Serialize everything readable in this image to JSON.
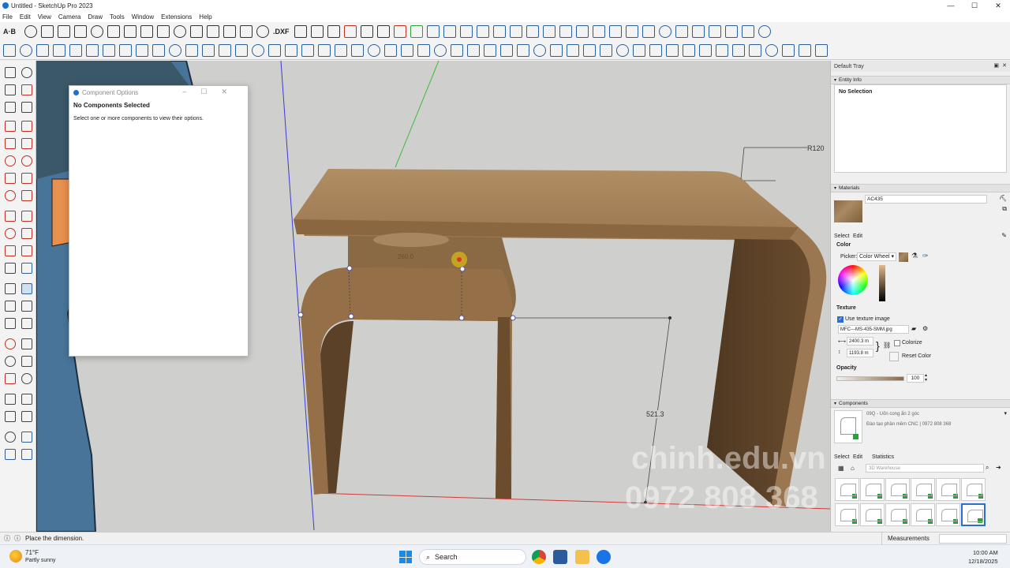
{
  "window": {
    "title": "Untitled - SketchUp Pro 2023"
  },
  "menu": [
    "File",
    "Edit",
    "View",
    "Camera",
    "Draw",
    "Tools",
    "Window",
    "Extensions",
    "Help"
  ],
  "toolbar": {
    "text_tool_label": "A·B",
    "dxf_label": ".DXF"
  },
  "viewport": {
    "dimension_radius": "R120",
    "dimension_top": "260.0",
    "dimension_height": "521.3",
    "watermark_site": "chinh.edu.vn",
    "watermark_phone": "0972 808 368"
  },
  "component_options": {
    "title": "Component Options",
    "heading": "No Components Selected",
    "message": "Select one or more components to view their options."
  },
  "tray": {
    "title": "Default Tray",
    "entity_info": {
      "section": "Entity Info",
      "value": "No Selection"
    },
    "materials": {
      "section": "Materials",
      "name": "AC435",
      "tab_select": "Select",
      "tab_edit": "Edit",
      "color_label": "Color",
      "picker_label": "Picker:",
      "picker_value": "Color Wheel",
      "texture_label": "Texture",
      "use_texture_label": "Use texture image",
      "texture_file": "MFC---MS-435-SMM.jpg",
      "width": "2400.3 m",
      "height": "1193.8 m",
      "colorize_label": "Colorize",
      "reset_color_label": "Reset Color",
      "opacity_label": "Opacity",
      "opacity_value": "100",
      "swatch_color": "#8a6a47"
    },
    "components": {
      "section": "Components",
      "name": "09Q - Uốn cong ẩn 2 góc",
      "description": "Đào tạo phần mềm CNC | 0972 808 368",
      "tab_select": "Select",
      "tab_edit": "Edit",
      "tab_statistics": "Statistics",
      "search_placeholder": "3D Warehouse"
    }
  },
  "status": {
    "hint": "Place the dimension.",
    "measurements_label": "Measurements"
  },
  "taskbar": {
    "weather_temp": "71°F",
    "weather_desc": "Partly sunny",
    "search_label": "Search",
    "time": "10:00 AM",
    "date": "12/18/2025"
  }
}
